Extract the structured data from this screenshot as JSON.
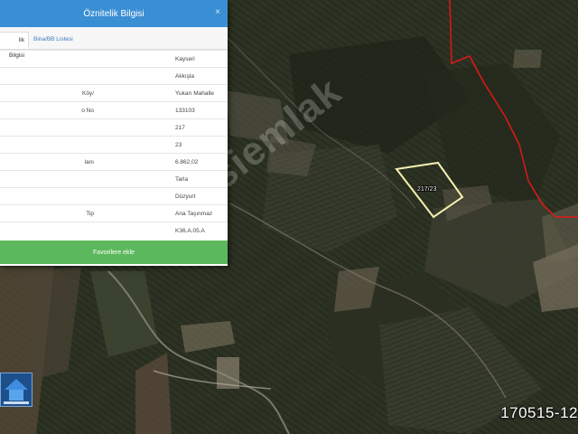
{
  "panel": {
    "title": "Öznitelik Bilgisi",
    "close": "×",
    "tabs": [
      {
        "label": "lik Bilgisi",
        "active": true
      },
      {
        "label": "Bina/BB Listesi",
        "active": false
      }
    ],
    "rows": [
      {
        "key": "",
        "value": "Kayseri"
      },
      {
        "key": "",
        "value": "Akkışla"
      },
      {
        "key": "/Köy",
        "value": "Yukarı Mahalle"
      },
      {
        "key": "o No",
        "value": "133103"
      },
      {
        "key": "",
        "value": "217"
      },
      {
        "key": "",
        "value": "23"
      },
      {
        "key": "lanı",
        "value": "6.862,02"
      },
      {
        "key": "",
        "value": "Tarla"
      },
      {
        "key": "",
        "value": "Düzyurt"
      },
      {
        "key": "Tip",
        "value": "Ana Taşınmaz"
      },
      {
        "key": "",
        "value": "K36.A.05.A"
      }
    ],
    "favorite_button": "Favorilere ekle"
  },
  "map": {
    "parcel_label": "217/23",
    "watermark": "hepsiemlak",
    "listing_id": "170515-12",
    "colors": {
      "parcel_outline": "#f4f0b0",
      "boundary_line": "#e01818",
      "header": "#3a8ed4",
      "button": "#5cb85c"
    }
  }
}
